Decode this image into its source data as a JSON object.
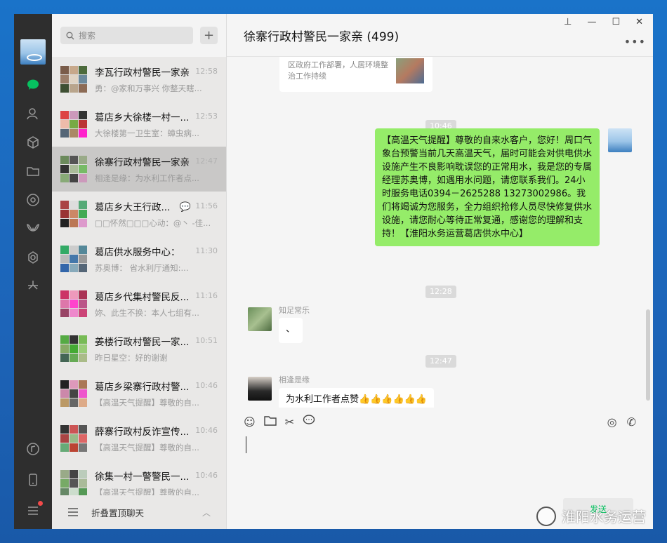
{
  "chat_header": {
    "title": "徐寨行政村警民一家亲 (499)"
  },
  "search": {
    "placeholder": "搜索"
  },
  "chat_list": [
    {
      "name": "李瓦行政村警民一家亲",
      "time": "12:58",
      "preview": "勇：@家和万事兴 你整天瞎..."
    },
    {
      "name": "葛店乡大徐楼一村一...",
      "time": "12:53",
      "preview": "大徐楼第一卫生室：蟑虫病..."
    },
    {
      "name": "徐寨行政村警民一家亲",
      "time": "12:47",
      "preview": "相逢是缘：为水利工作者点..."
    },
    {
      "name": "葛店乡大王行政...",
      "time": "11:56",
      "preview": "□□怀然□□□心动：@丶 -佳..."
    },
    {
      "name": "葛店供水服务中心：",
      "time": "11:30",
      "preview": "苏奥博：   省水利厅通知:..."
    },
    {
      "name": "葛店乡代集村警民反...",
      "time": "11:16",
      "preview": "妳、此生不换：本人七组有..."
    },
    {
      "name": "姜楼行政村警民一家...",
      "time": "10:51",
      "preview": "昨日星空：好的谢谢"
    },
    {
      "name": "葛店乡梁寨行政村警...",
      "time": "10:46",
      "preview": "【高温天气提醒】尊敬的自..."
    },
    {
      "name": "薛寨行政村反诈宣传...",
      "time": "10:46",
      "preview": "【高温天气提醒】尊敬的自..."
    },
    {
      "name": "徐集一村一警警民一...",
      "time": "10:46",
      "preview": "【高温天气提醒】尊敬的自..."
    }
  ],
  "fold": {
    "label": "折叠置顶聊天"
  },
  "messages": {
    "card_text": "区政府工作部署，人居环境整治工作持续",
    "time1": "10:46",
    "green_text": "【高温天气提醒】尊敬的自来水客户，您好！周口气象台预警当前几天高温天气，届时可能会对供电供水设施产生不良影响耽误您的正常用水，我是您的专属经理苏奥博，如遇用水问题，请您联系我们。24小时服务电话0394－2625288 13273002986。我们将竭诚为您服务，全力组织抢修人员尽快修复供水设施，请您耐心等待正常复通，感谢您的理解和支持！【淮阳水务运营葛店供水中心】",
    "time2": "12:28",
    "sender1": "知足常乐",
    "msg1": "、",
    "time3": "12:47",
    "sender2": "相逢是缘",
    "msg2": "为水利工作者点赞👍👍👍👍👍👍"
  },
  "watermark": {
    "text": "淮阳水务运营"
  },
  "send": {
    "label": "发送"
  },
  "colors": {
    "accent_green": "#07c160",
    "bubble_green": "#95ec69",
    "sidebar_dark": "#2e2e2e"
  }
}
